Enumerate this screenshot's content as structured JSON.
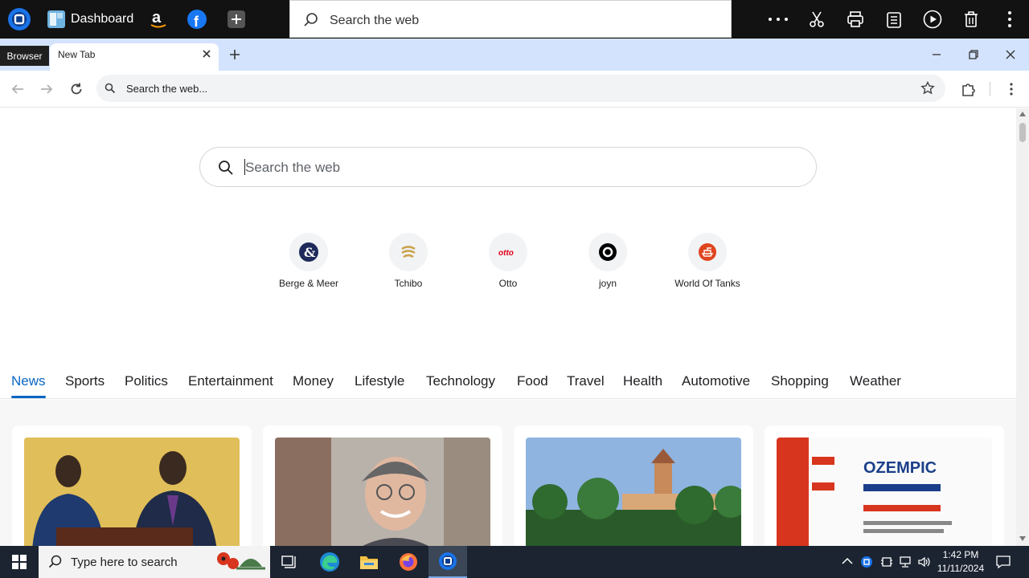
{
  "topbar": {
    "dashboard_label": "Dashboard",
    "search_placeholder": "Search the web"
  },
  "tabstrip": {
    "browser_badge": "Browser",
    "tab_title": "New Tab"
  },
  "addressbar": {
    "omnibox_text": "Search the web..."
  },
  "main": {
    "search_placeholder": "Search the web",
    "tiles": [
      {
        "label": "Berge & Meer",
        "icon": "berge-meer-logo",
        "color": "#1e2a5a"
      },
      {
        "label": "Tchibo",
        "icon": "tchibo-logo",
        "color": "#c9a24a"
      },
      {
        "label": "Otto",
        "icon": "otto-logo",
        "color": "#e2001a"
      },
      {
        "label": "joyn",
        "icon": "joyn-logo",
        "color": "#000000"
      },
      {
        "label": "World Of Tanks",
        "icon": "world-of-tanks-logo",
        "color": "#e0451f"
      }
    ],
    "categories": [
      "News",
      "Sports",
      "Politics",
      "Entertainment",
      "Money",
      "Lifestyle",
      "Technology",
      "Food",
      "Travel",
      "Health",
      "Automotive",
      "Shopping",
      "Weather"
    ],
    "active_category": "News"
  },
  "taskbar": {
    "search_placeholder": "Type here to search",
    "time": "1:42 PM",
    "date": "11/11/2024"
  },
  "colors": {
    "accent": "#0a66c2",
    "tabstrip": "#d3e3fd",
    "taskbar": "#1c2431"
  }
}
